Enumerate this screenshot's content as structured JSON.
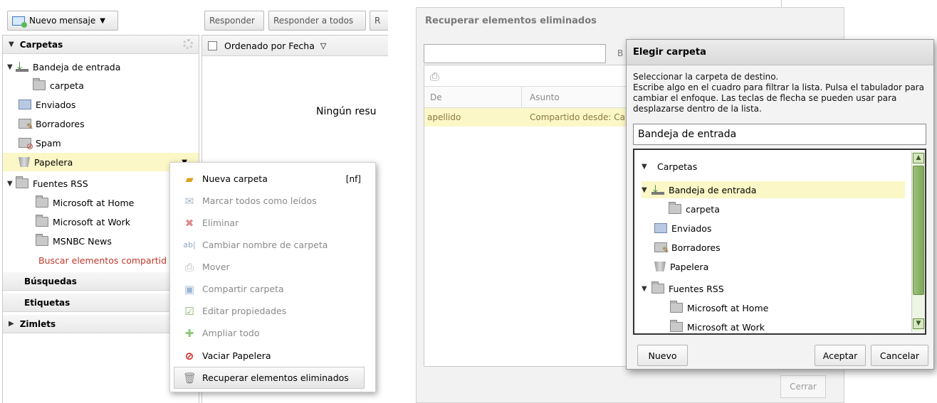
{
  "toolbar": {
    "new_message": "Nuevo mensaje",
    "reply": "Responder",
    "reply_all": "Responder a todos",
    "forward_partial": "R"
  },
  "folders": {
    "section_title": "Carpetas",
    "items": [
      {
        "label": "Bandeja de entrada",
        "icon": "inbox-icon"
      },
      {
        "label": "carpeta",
        "icon": "folder-icon"
      },
      {
        "label": "Enviados",
        "icon": "sent-icon"
      },
      {
        "label": "Borradores",
        "icon": "drafts-icon"
      },
      {
        "label": "Spam",
        "icon": "spam-icon"
      },
      {
        "label": "Papelera",
        "icon": "trash-icon"
      },
      {
        "label": "Fuentes RSS",
        "icon": "folder-icon"
      },
      {
        "label": "Microsoft at Home",
        "icon": "folder-icon"
      },
      {
        "label": "Microsoft at Work",
        "icon": "folder-icon"
      },
      {
        "label": "MSNBC News",
        "icon": "folder-icon"
      }
    ],
    "search_shared": "Buscar elementos compartid",
    "sections": [
      "Búsquedas",
      "Etiquetas",
      "Zimlets"
    ]
  },
  "list": {
    "sort_label": "Ordenado por Fecha",
    "empty_text": "Ningún resu"
  },
  "context_menu": {
    "items": [
      {
        "label": "Nueva carpeta",
        "shortcut": "[nf]",
        "icon": "new-folder-icon",
        "enabled": true
      },
      {
        "label": "Marcar todos como leídos",
        "icon": "mark-read-icon",
        "enabled": false
      },
      {
        "label": "Eliminar",
        "icon": "delete-icon",
        "enabled": false
      },
      {
        "label": "Cambiar nombre de carpeta",
        "icon": "rename-icon",
        "enabled": false
      },
      {
        "label": "Mover",
        "icon": "move-icon",
        "enabled": false
      },
      {
        "label": "Compartir carpeta",
        "icon": "share-icon",
        "enabled": false
      },
      {
        "label": "Editar propiedades",
        "icon": "edit-properties-icon",
        "enabled": false
      },
      {
        "label": "Ampliar todo",
        "icon": "expand-icon",
        "enabled": false
      },
      {
        "label": "Vaciar Papelera",
        "icon": "empty-trash-icon",
        "enabled": true
      },
      {
        "label": "Recuperar elementos eliminados",
        "icon": "recover-icon",
        "enabled": true
      }
    ]
  },
  "recover_dialog": {
    "title": "Recuperar elementos eliminados",
    "search_button_partial": "B",
    "col_from": "De",
    "col_subject": "Asunto",
    "row_from": "apellido",
    "row_subject": "Compartido desde: Ca",
    "close": "Cerrar"
  },
  "choose_dialog": {
    "title": "Elegir carpeta",
    "description": "Seleccionar la carpeta de destino.\nEscribe algo en el cuadro para filtrar la lista. Pulsa el tabulador para cambiar el enfoque. Las teclas de flecha se pueden usar para desplazarse dentro de la lista.",
    "filter_value": "Bandeja de entrada",
    "tree": [
      "Carpetas",
      "Bandeja de entrada",
      "carpeta",
      "Enviados",
      "Borradores",
      "Papelera",
      "Fuentes RSS",
      "Microsoft at Home",
      "Microsoft at Work"
    ],
    "new_button": "Nuevo",
    "accept_button": "Aceptar",
    "cancel_button": "Cancelar"
  },
  "colors": {
    "selection": "#fbf7c7",
    "link_red": "#c0392b",
    "scroll_green": "#7ea85b"
  }
}
